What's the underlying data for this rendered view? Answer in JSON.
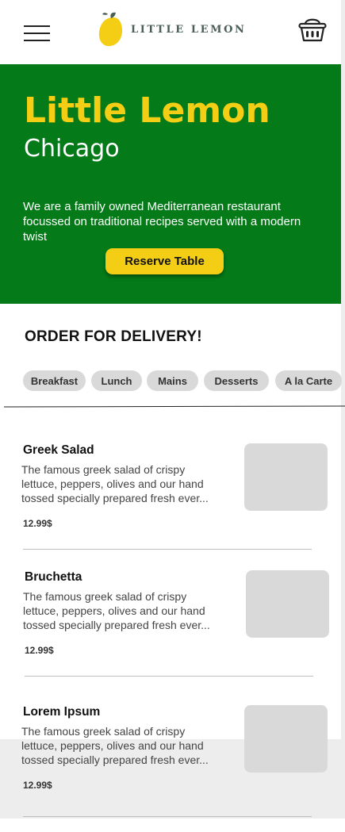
{
  "header": {
    "logo_text": "LITTLE LEMON",
    "menu_icon": "hamburger-menu-icon",
    "cart_icon": "basket-icon"
  },
  "hero": {
    "title": "Little Lemon",
    "subtitle": "Chicago",
    "description": "We are a family owned Mediterranean restaurant focussed on traditional recipes served with a modern twist",
    "reserve_label": "Reserve Table"
  },
  "order": {
    "title": "ORDER FOR DELIVERY!",
    "categories": [
      "Breakfast",
      "Lunch",
      "Mains",
      "Desserts",
      "A la Carte"
    ]
  },
  "menu_items": [
    {
      "name": "Greek Salad",
      "description_lines": [
        "The famous greek salad of  crispy",
        "lettuce, peppers, olives and our hand",
        "tossed specially prepared fresh ever..."
      ],
      "price": "12.99$"
    },
    {
      "name": "Bruchetta",
      "description_lines": [
        "The famous greek salad of  crispy",
        "lettuce, peppers, olives and our hand",
        "tossed specially prepared fresh ever..."
      ],
      "price": "12.99$"
    },
    {
      "name": "Lorem Ipsum",
      "description_lines": [
        "The famous greek salad of  crispy",
        "lettuce, peppers, olives and our hand",
        "tossed specially prepared fresh ever..."
      ],
      "price": "12.99$"
    }
  ],
  "colors": {
    "hero_green": "#047a18",
    "accent_yellow": "#f4ce14",
    "logo_text": "#495e57",
    "pill_gray": "#d9d9d9"
  }
}
